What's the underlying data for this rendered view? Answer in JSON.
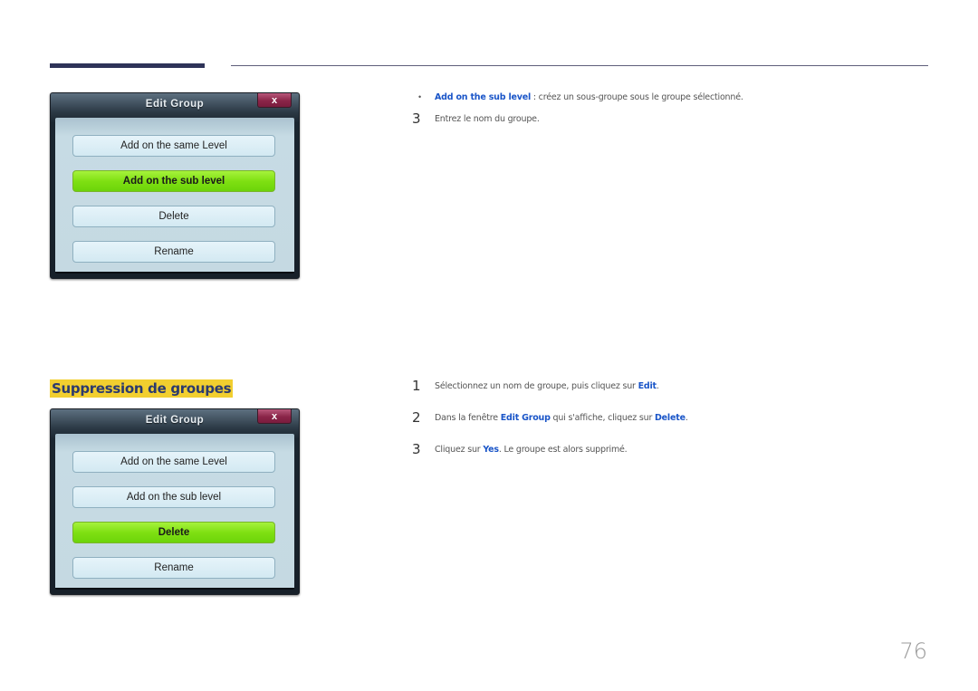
{
  "dialog_top": {
    "title": "Edit Group",
    "close_label": "x",
    "buttons": [
      {
        "label": "Add on the same Level",
        "active": false
      },
      {
        "label": "Add on the sub level",
        "active": true
      },
      {
        "label": "Delete",
        "active": false
      },
      {
        "label": "Rename",
        "active": false
      }
    ]
  },
  "dialog_bottom": {
    "title": "Edit Group",
    "close_label": "x",
    "buttons": [
      {
        "label": "Add on the same Level",
        "active": false
      },
      {
        "label": "Add on the sub level",
        "active": false
      },
      {
        "label": "Delete",
        "active": true
      },
      {
        "label": "Rename",
        "active": false
      }
    ]
  },
  "top_text": {
    "bullet": "•",
    "bullet_item": {
      "highlight": "Add on the sub level",
      "rest": " : créez un sous-groupe sous le groupe sélectionné."
    },
    "step3": {
      "number": "3",
      "text": "Entrez le nom du groupe."
    }
  },
  "section": {
    "heading": "Suppression de groupes",
    "steps": [
      {
        "number": "1",
        "parts": [
          {
            "t": "Sélectionnez un nom de groupe, puis cliquez sur "
          },
          {
            "t": "Edit",
            "hl": true
          },
          {
            "t": "."
          }
        ]
      },
      {
        "number": "2",
        "parts": [
          {
            "t": "Dans la fenêtre "
          },
          {
            "t": "Edit Group",
            "hl": true
          },
          {
            "t": " qui s'affiche, cliquez sur "
          },
          {
            "t": "Delete",
            "hl": true
          },
          {
            "t": "."
          }
        ]
      },
      {
        "number": "3",
        "parts": [
          {
            "t": "Cliquez sur "
          },
          {
            "t": "Yes",
            "hl": true
          },
          {
            "t": ". Le groupe est alors supprimé."
          }
        ]
      }
    ]
  },
  "colors": {
    "highlight": "#1a55c8",
    "heading_bg": "#f2cf2f",
    "active_button": "#7fe012"
  },
  "page_number": "76"
}
